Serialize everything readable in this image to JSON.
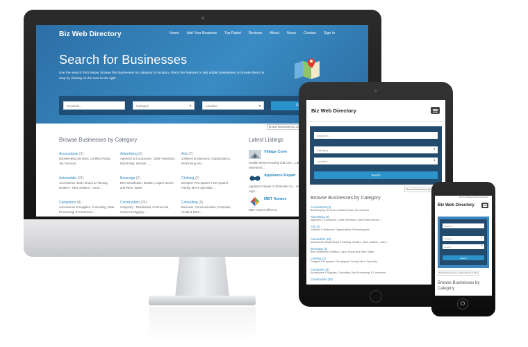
{
  "site": {
    "brand": "Biz Web Directory",
    "nav": [
      "Home",
      "Add Your Business",
      "Top Rated",
      "Reviews",
      "About",
      "News",
      "Contact",
      "Sign In"
    ]
  },
  "hero": {
    "title": "Search for Businesses",
    "description": "Use the search form below, browse the businesses by category or location, check the featured or last added businesses or browse them by map by clicking on the icon to the right ...",
    "keyword_placeholder": "Keyword...",
    "category_label": "Category",
    "location_label": "Location",
    "search_label": "Search",
    "browse_location_label": "Browse Businesses by Location"
  },
  "browse": {
    "title": "Browse Businesses by Category",
    "categories": [
      {
        "name": "Accountants",
        "count": "(3)",
        "sub": "Bookkeeping Services, Certified Public, Tax Services"
      },
      {
        "name": "Advertising",
        "count": "(6)",
        "sub": "Agencies & Counselors, Cable Television, Direct Mail, Internet ..."
      },
      {
        "name": "Arts",
        "count": "(2)",
        "sub": "Galleries & Museums, Organizations, Performing Arts"
      },
      {
        "name": "Automobile",
        "count": "(24)",
        "sub": "Accessories, Body Shops & Painting, Dealers - New, Dealers - Used ..."
      },
      {
        "name": "Beverage",
        "count": "(2)",
        "sub": "Beer Distribution, Bottlers, Liquor Stores and Wine, Water"
      },
      {
        "name": "Clothing",
        "count": "(2)",
        "sub": "Designer Pet Apparel, Fine Apparel, Family, Men's Specialty ..."
      },
      {
        "name": "Computers",
        "count": "(8)",
        "sub": "Accessories & Supplies, Consulting, Data Processing, E-Commerce ..."
      },
      {
        "name": "Construction",
        "count": "(25)",
        "sub": "Carpentry - Residential, Commercial, Cranes & Rigging ..."
      },
      {
        "name": "Consulting",
        "count": "(5)",
        "sub": "Business, Communication, Computer, Credit & Debt ..."
      }
    ]
  },
  "latest": {
    "title": "Latest Listings",
    "items": [
      {
        "name": "Village Cove",
        "desc": "Seattle Senior Housing and com... Lake with all the retirement..."
      },
      {
        "name": "Appliance Repair",
        "desc": "Appliance Repair in Riverside Co... residential & commercial Appl..."
      },
      {
        "name": "MBT Homes",
        "desc": "MBT Homes offers O..."
      }
    ]
  },
  "tablet": {
    "brand": "Biz Web Directory",
    "keyword_placeholder": "Keyword...",
    "category_label": "Category",
    "location_label": "Location",
    "search_label": "Search",
    "browse_location_label": "Browse Businesses by Location",
    "browse_title": "Browse Businesses by Category",
    "categories": [
      {
        "name": "Accountants (3)",
        "sub": "Bookkeeping Services, Certified Public, Tax Services"
      },
      {
        "name": "Advertising (6)",
        "sub": "Agencies & Counselors, Cable Television, Direct Mail, Internet ..."
      },
      {
        "name": "Arts (2)",
        "sub": "Galleries & Museums, Organizations, Performing Arts"
      },
      {
        "name": "Automobile (24)",
        "sub": "Accessories, Body Shops & Painting, Dealers - New, Dealers - Used ..."
      },
      {
        "name": "Beverage (2)",
        "sub": "Beer Distribution, Bottlers, Liquor Stores and Wine, Water"
      },
      {
        "name": "Clothing (2)",
        "sub": "Designer Pet Apparel, Fine Apparel, Family, Men's Specialty ..."
      },
      {
        "name": "Computers (8)",
        "sub": "Accessories & Supplies, Consulting, Data Processing, E-Commerce ..."
      },
      {
        "name": "Construction (25)",
        "sub": ""
      }
    ]
  },
  "phone": {
    "top_nav": "Add Your Business   Rate Us   Reviews",
    "brand": "Biz Web Directory",
    "keyword_placeholder": "Keyword...",
    "category_label": "Category",
    "location_label": "Location",
    "search_label": "Search",
    "browse_location_label": "Browse Businesses by Location",
    "browse_map_label": "Browse by Map",
    "browse_title": "Browse Businesses by Category"
  },
  "colors": {
    "hero_blue": "#3a8bc4",
    "search_strip": "#1f4f77",
    "button_blue": "#2b93c9",
    "link_blue": "#2b89c3"
  }
}
